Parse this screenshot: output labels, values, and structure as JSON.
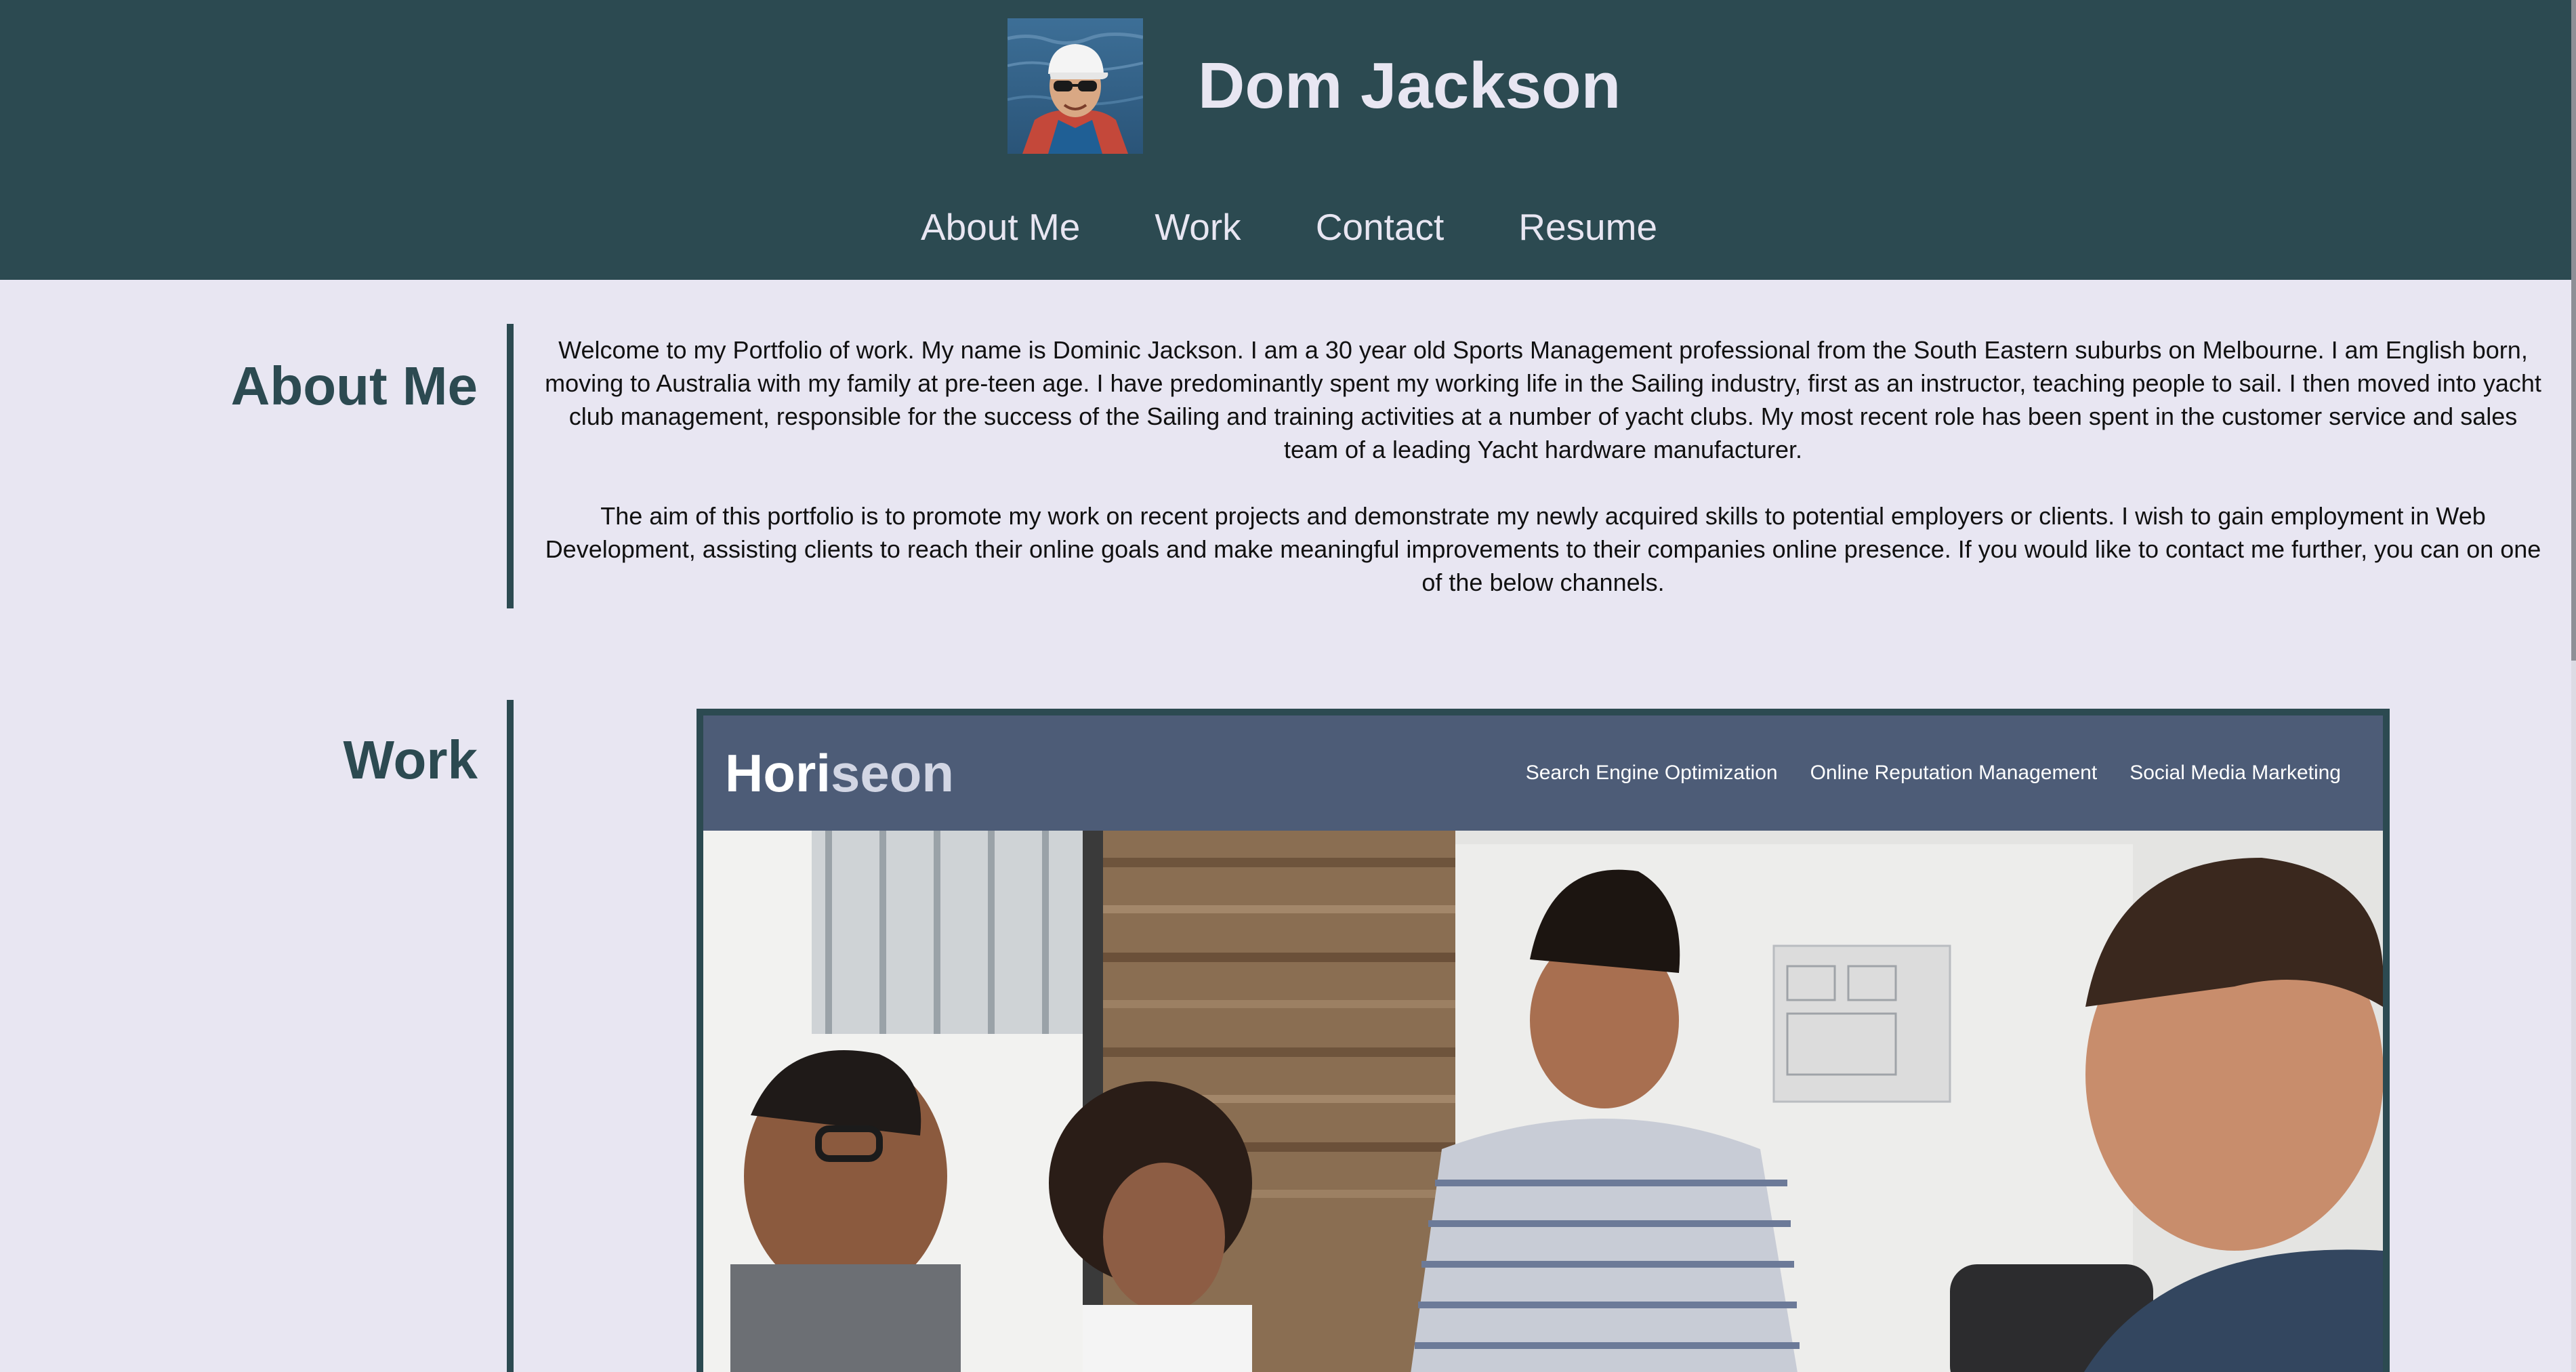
{
  "header": {
    "title": "Dom Jackson",
    "avatar_icon": "profile-photo",
    "nav": [
      {
        "label": "About Me"
      },
      {
        "label": "Work"
      },
      {
        "label": "Contact"
      },
      {
        "label": "Resume"
      }
    ]
  },
  "about": {
    "heading": "About Me",
    "paragraphs": [
      "Welcome to my Portfolio of work. My name is Dominic Jackson. I am a 30 year old Sports Management professional from the South Eastern suburbs on Melbourne. I am English born, moving to Australia with my family at pre-teen age. I have predominantly spent my working life in the Sailing industry, first as an instructor, teaching people to sail. I then moved into yacht club management, responsible for the success of the Sailing and training activities at a number of yacht clubs. My most recent role has been spent in the customer service and sales team of a leading Yacht hardware manufacturer.",
      "The aim of this portfolio is to promote my work on recent projects and demonstrate my newly acquired skills to potential employers or clients. I wish to gain employment in Web Development, assisting clients to reach their online goals and make meaningful improvements to their companies online presence. If you would like to contact me further, you can on one of the below channels."
    ]
  },
  "work": {
    "heading": "Work",
    "project": {
      "logo_part1": "Hori",
      "logo_part2": "seon",
      "nav": [
        {
          "label": "Search Engine Optimization"
        },
        {
          "label": "Online Reputation Management"
        },
        {
          "label": "Social Media Marketing"
        }
      ]
    }
  },
  "colors": {
    "header_bg": "#2c4a51",
    "page_bg": "#e8e6f2",
    "card_header_bg": "#4d5c77",
    "heading_text": "#2c4a51"
  }
}
